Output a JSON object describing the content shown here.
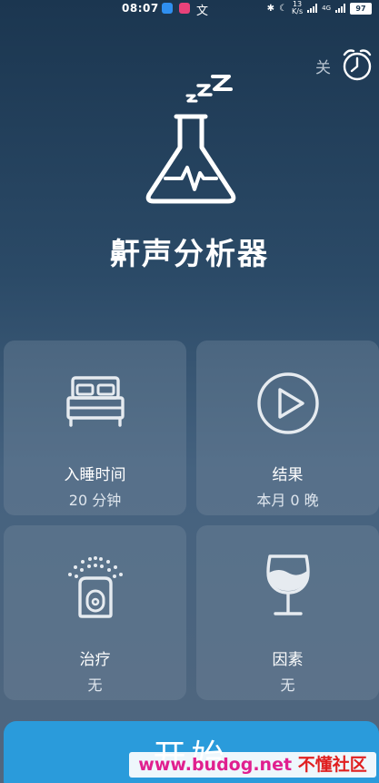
{
  "status_bar": {
    "time": "08:07",
    "net_speed": "13\nK/s",
    "battery": "97",
    "network_type": "4G"
  },
  "alarm": {
    "label": "关"
  },
  "app": {
    "title": "鼾声分析器"
  },
  "cards": [
    {
      "label": "入睡时间",
      "value": "20 分钟"
    },
    {
      "label": "结果",
      "value": "本月 0 晚"
    },
    {
      "label": "治疗",
      "value": "无"
    },
    {
      "label": "因素",
      "value": "无"
    }
  ],
  "start_button": {
    "label": "开始"
  },
  "watermark": {
    "en": "www.budog.net",
    "cn": "不懂社区"
  },
  "colors": {
    "accent": "#2a9bdb",
    "background_top": "#1b3650",
    "background_bottom": "#51677f"
  }
}
